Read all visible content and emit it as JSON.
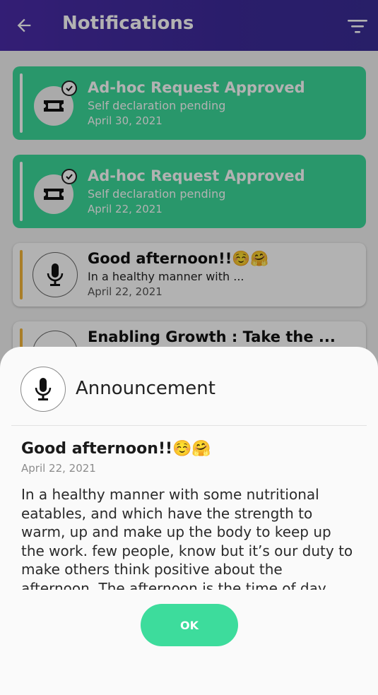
{
  "header": {
    "title": "Notifications",
    "back_icon": "arrow-left-icon",
    "filter_icon": "filter-icon"
  },
  "notifications": [
    {
      "title": "Ad-hoc Request Approved",
      "subtitle": "Self declaration pending",
      "date": "April 30, 2021",
      "icon": "ticket-icon",
      "status_icon": "check-circle-icon",
      "color": "#3cd89a"
    },
    {
      "title": "Ad-hoc Request Approved",
      "subtitle": "Self declaration pending",
      "date": "April 22, 2021",
      "icon": "ticket-icon",
      "status_icon": "check-circle-icon",
      "color": "#3cd89a"
    },
    {
      "title": "Good afternoon!!☺️🤗",
      "subtitle": "In a healthy manner with ...",
      "date": "April 22, 2021",
      "icon": "microphone-icon",
      "color": "#ffffff"
    },
    {
      "title": "Enabling Growth : Take the ...",
      "icon": "microphone-icon",
      "color": "#ffffff"
    }
  ],
  "sheet": {
    "heading": "Announcement",
    "icon": "microphone-icon",
    "title": "Good afternoon!!☺️🤗",
    "date": "April 22, 2021",
    "body": "In a healthy manner with some nutritional eatables, and which have the strength to warm, up and make up the body to keep up the work. few people, know but it’s our duty to make others think positive about the afternoon. The afternoon is the time of day",
    "ok_label": "OK"
  },
  "colors": {
    "appbar": "#4a2ca8",
    "accent_green": "#3cd89a",
    "ok_button": "#3ddc9c",
    "announcement_bar": "#f2b53a"
  }
}
